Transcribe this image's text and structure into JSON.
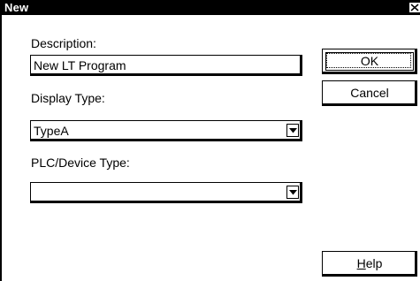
{
  "window": {
    "title": "New",
    "close_glyph": "✕"
  },
  "form": {
    "description_label": "Description:",
    "description_value": "New LT Program",
    "display_type_label": "Display Type:",
    "display_type_value": "TypeA",
    "plc_device_type_label": "PLC/Device Type:",
    "plc_device_type_value": ""
  },
  "buttons": {
    "ok": "OK",
    "cancel": "Cancel",
    "help_mnemonic": "H",
    "help_rest": "elp"
  },
  "icons": {
    "close": "close-icon",
    "dropdown": "chevron-down-icon"
  }
}
